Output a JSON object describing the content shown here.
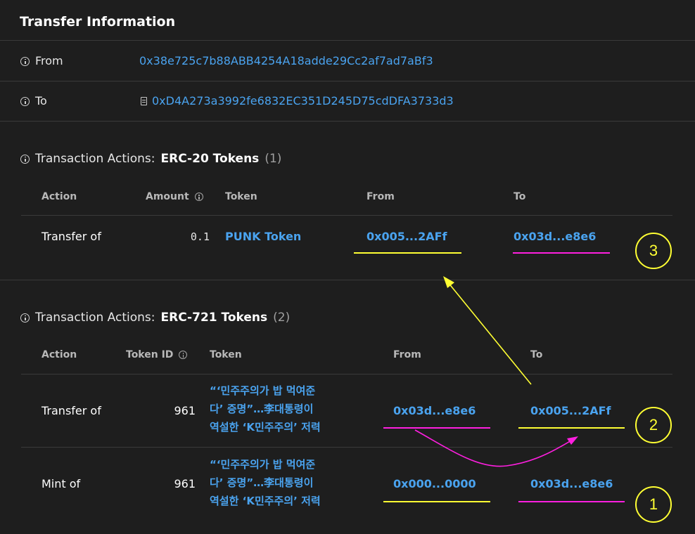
{
  "header": {
    "title": "Transfer Information"
  },
  "transfer": {
    "from_label": "From",
    "from_address": "0x38e725c7b88ABB4254A18adde29Cc2af7ad7aBf3",
    "to_label": "To",
    "to_address": "0xD4A273a3992fe6832EC351D245D75cdDFA3733d3"
  },
  "erc20": {
    "title_prefix": "Transaction Actions:",
    "title_strong": "ERC-20 Tokens",
    "count": "(1)",
    "columns": [
      "Action",
      "Amount",
      "Token",
      "From",
      "To"
    ],
    "rows": [
      {
        "action": "Transfer of",
        "amount": "0.1",
        "token": "PUNK Token",
        "from": "0x005...2AFf",
        "to": "0x03d...e8e6"
      }
    ]
  },
  "erc721": {
    "title_prefix": "Transaction Actions:",
    "title_strong": "ERC-721 Tokens",
    "count": "(2)",
    "columns": [
      "Action",
      "Token ID",
      "Token",
      "From",
      "To"
    ],
    "rows": [
      {
        "action": "Transfer of",
        "token_id": "961",
        "token_lines": [
          "“‘민주주의가 밥 먹여준",
          "다’ 증명”…李대통령이",
          "역설한 ‘K민주주의’ 저력"
        ],
        "from": "0x03d...e8e6",
        "to": "0x005...2AFf"
      },
      {
        "action": "Mint of",
        "token_id": "961",
        "token_lines": [
          "“‘민주주의가 밥 먹여준",
          "다’ 증명”…李대통령이",
          "역설한 ‘K민주주의’ 저력"
        ],
        "from": "0x000...0000",
        "to": "0x03d...e8e6"
      }
    ]
  },
  "annotations": {
    "markers": [
      "3",
      "2",
      "1"
    ],
    "colors": {
      "yellow": "#ffff33",
      "magenta": "#ff1fe0",
      "link": "#4aa3ef",
      "background": "#1e1e1e"
    }
  }
}
